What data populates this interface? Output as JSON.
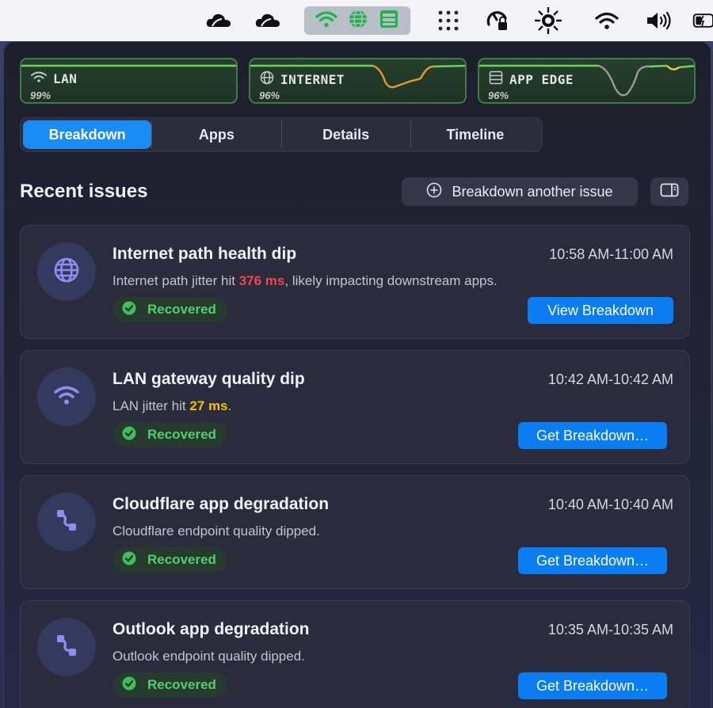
{
  "colors": {
    "accent": "#1a8cf5",
    "action": "#0a7df2",
    "metric_border": "#3f7c47",
    "recovered": "#4fd06a",
    "alert_red": "#f0474a",
    "alert_yellow": "#f2c200"
  },
  "menubar": {
    "icons": [
      "cloud-icon",
      "cloud-icon",
      "wifi-status-icon",
      "globe-status-icon",
      "server-status-icon",
      "app-grid-icon",
      "lock-gauge-icon",
      "sun-icon",
      "wifi-icon",
      "volume-icon",
      "battery-icon"
    ]
  },
  "metrics": [
    {
      "label": "LAN",
      "value": "99%",
      "icon": "wifi-icon"
    },
    {
      "label": "INTERNET",
      "value": "96%",
      "icon": "globe-icon"
    },
    {
      "label": "APP EDGE",
      "value": "96%",
      "icon": "server-icon"
    }
  ],
  "tabs": [
    {
      "label": "Breakdown",
      "active": true
    },
    {
      "label": "Apps",
      "active": false
    },
    {
      "label": "Details",
      "active": false
    },
    {
      "label": "Timeline",
      "active": false
    }
  ],
  "section": {
    "title": "Recent issues",
    "another_label": "Breakdown another issue"
  },
  "issues": [
    {
      "title": "Internet path health dip",
      "time": "10:58 AM-11:00 AM",
      "desc_pre": "Internet path jitter hit ",
      "desc_value": "376 ms",
      "desc_post": ", likely impacting downstream apps.",
      "status": "Recovered",
      "action": "View Breakdown",
      "icon": "globe-icon"
    },
    {
      "title": "LAN gateway quality dip",
      "time": "10:42 AM-10:42 AM",
      "desc_pre": "LAN jitter hit ",
      "desc_value": "27 ms",
      "desc_post": ".",
      "status": "Recovered",
      "action": "Get Breakdown…",
      "icon": "wifi-icon"
    },
    {
      "title": "Cloudflare app degradation",
      "time": "10:40 AM-10:40 AM",
      "desc": "Cloudflare endpoint quality dipped.",
      "status": "Recovered",
      "action": "Get Breakdown…",
      "icon": "route-icon"
    },
    {
      "title": "Outlook app degradation",
      "time": "10:35 AM-10:35 AM",
      "desc": "Outlook endpoint quality dipped.",
      "status": "Recovered",
      "action": "Get Breakdown…",
      "icon": "route-icon"
    }
  ]
}
